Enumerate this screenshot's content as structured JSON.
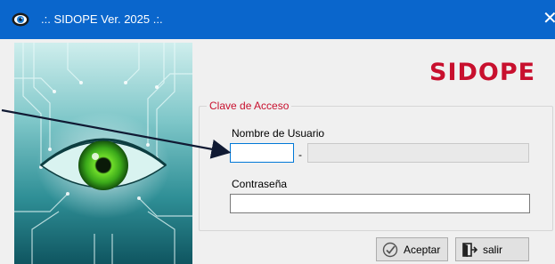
{
  "window": {
    "title": ".:. SIDOPE Ver. 2025 .:.",
    "close_glyph": "✕",
    "icon": "eye-icon",
    "titlebar_color": "#0a66cc"
  },
  "logo": {
    "text": "SIDOPE",
    "color": "#c8102e"
  },
  "login_group": {
    "legend": "Clave de Acceso",
    "username": {
      "label": "Nombre de Usuario",
      "value": "",
      "separator": "-",
      "secondary_value": ""
    },
    "password": {
      "label": "Contraseña",
      "value": ""
    }
  },
  "buttons": {
    "accept": {
      "label": "Aceptar",
      "icon": "check-icon"
    },
    "exit": {
      "label": "salir",
      "icon": "exit-door-icon"
    }
  },
  "annotation": {
    "type": "arrow",
    "color": "#101a33"
  }
}
